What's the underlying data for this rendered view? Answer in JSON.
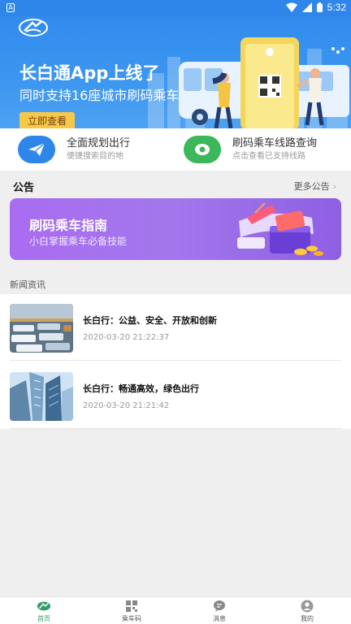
{
  "status_bar": {
    "time": "5:32",
    "left_badge": "A"
  },
  "banner": {
    "title": "长白通App上线了",
    "subtitle": "同时支持16座城市刷码乘车",
    "cta": "立即查看"
  },
  "quick_actions": [
    {
      "title": "全面规划出行",
      "subtitle": "便捷搜索目的地",
      "icon": "paper-plane-icon",
      "color": "#2f86ea"
    },
    {
      "title": "刷码乘车线路查询",
      "subtitle": "点击查看已支持线路",
      "icon": "location-pin-icon",
      "color": "#3cb85a"
    }
  ],
  "notice": {
    "title": "公告",
    "more": "更多公告",
    "banner_title": "刷码乘车指南",
    "banner_subtitle": "小白掌握乘车必备技能"
  },
  "news": {
    "header": "新闻资讯",
    "items": [
      {
        "title": "长白行：公益、安全、开放和创新",
        "time": "2020-03-20 21:22:37",
        "thumb": "buses-photo"
      },
      {
        "title": "长白行：畅通高效，绿色出行",
        "time": "2020-03-20 21:21:42",
        "thumb": "buildings-photo"
      }
    ]
  },
  "tabs": [
    {
      "label": "首页",
      "icon": "home-logo-icon",
      "active": true
    },
    {
      "label": "乘车码",
      "icon": "qr-code-icon",
      "active": false
    },
    {
      "label": "消息",
      "icon": "message-icon",
      "active": false
    },
    {
      "label": "我的",
      "icon": "user-icon",
      "active": false
    }
  ],
  "colors": {
    "brand_blue": "#2f86ea",
    "accent_green": "#2f9e6a",
    "guide_purple": "#a277ec",
    "cta_yellow": "#f6c84a"
  }
}
